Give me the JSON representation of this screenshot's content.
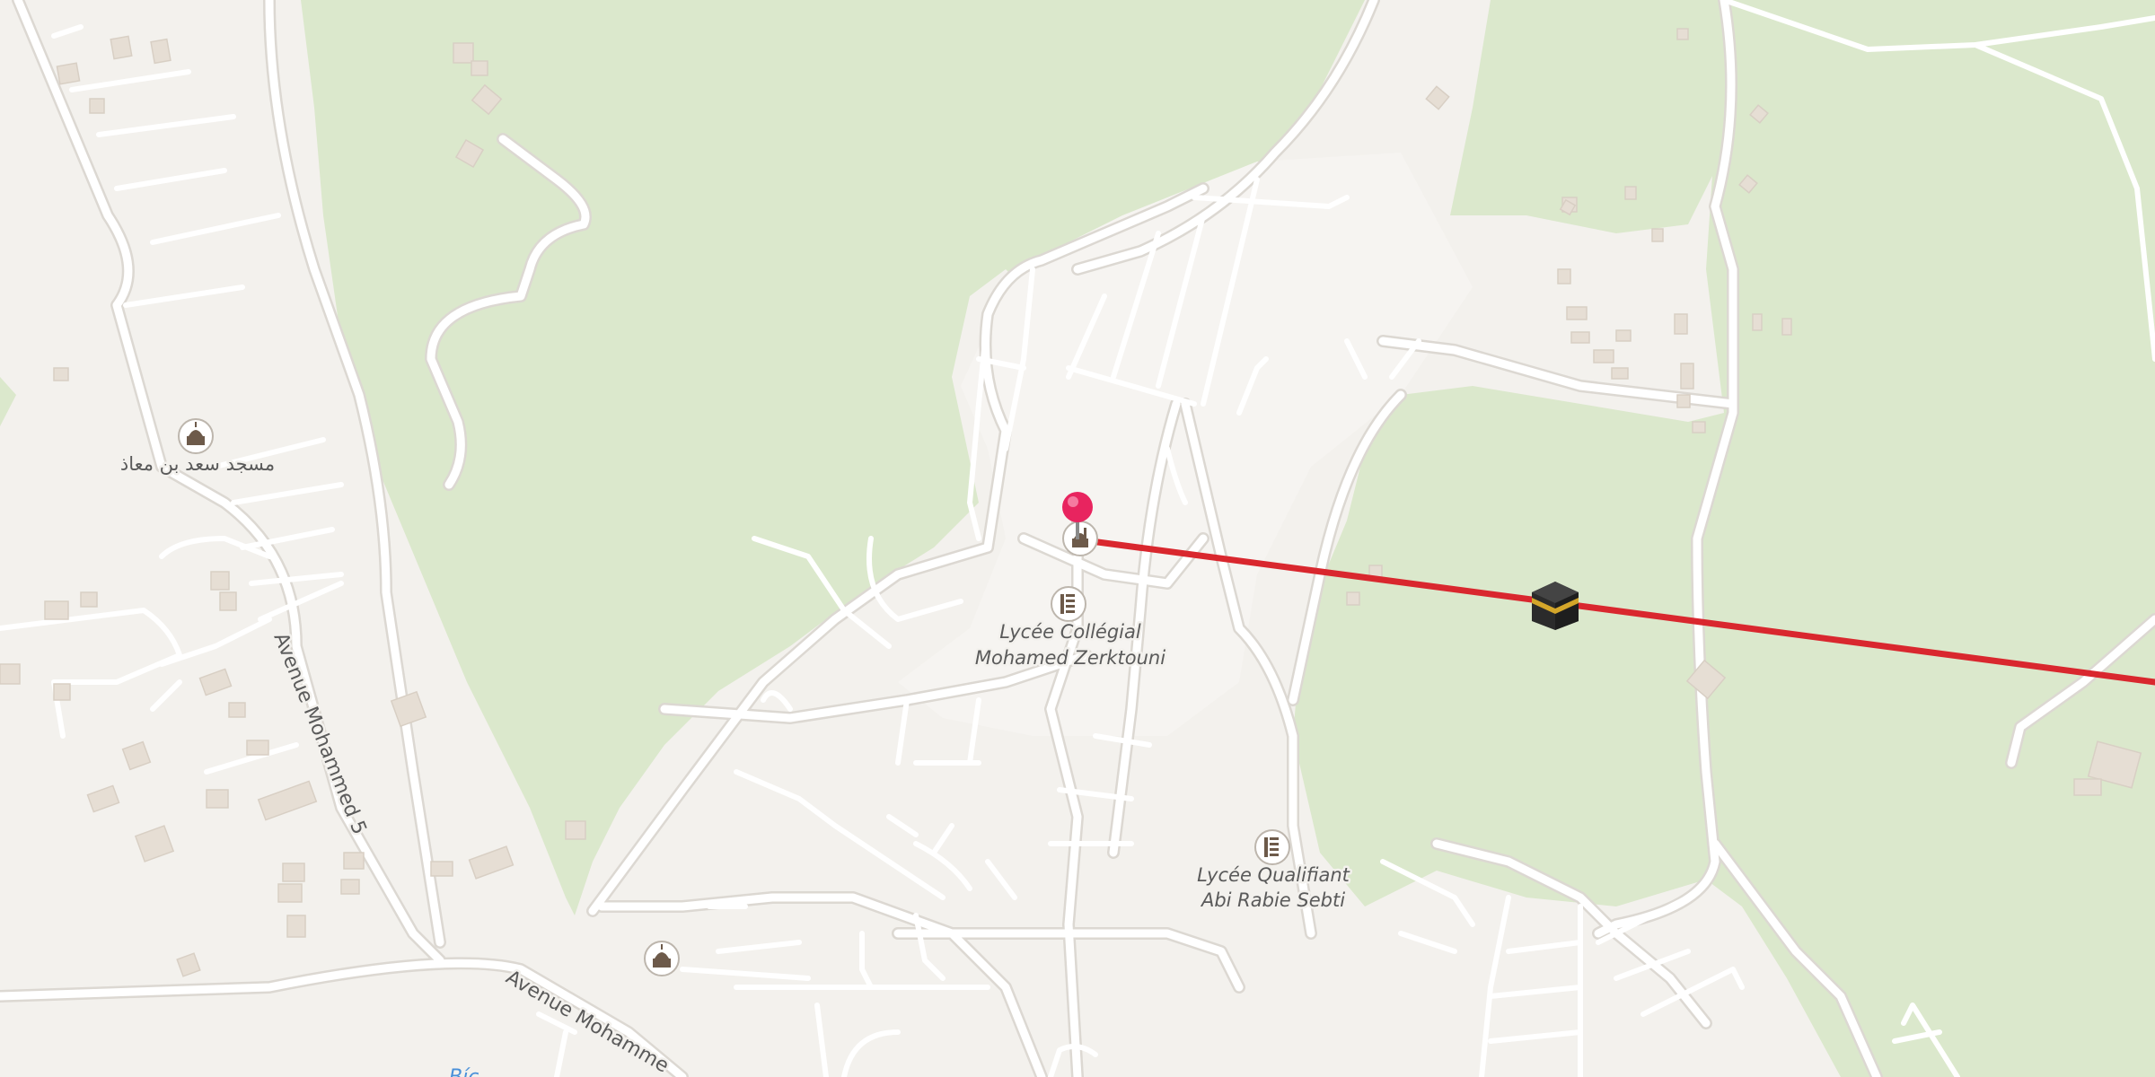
{
  "map": {
    "labels": {
      "school_1_line1": "Lycée Collégial",
      "school_1_line2": "Mohamed Zerktouni",
      "school_2_line1": "Lycée Qualifiant",
      "school_2_line2": "Abi Rabie Sebti",
      "mosque_name": "مسجد سعد بن معاذ",
      "street_avenue_m5": "Avenue Mohammed 5",
      "street_avenue_bottom": "Avenue Mohamme",
      "partial_blue_label": "Bíc"
    },
    "icons": {
      "pin": "map-pin-icon",
      "kaaba": "kaaba-icon",
      "mosque": "mosque-icon",
      "school": "school-icon"
    },
    "colors": {
      "land": "#f3f1ed",
      "park": "#dbe8cc",
      "road": "#ffffff",
      "bearing_line": "#d9272e",
      "pin": "#e8245f",
      "water_label": "#4a90d9"
    },
    "overlay": {
      "type": "qibla-bearing-line",
      "destination_icon": "kaaba-icon"
    }
  }
}
